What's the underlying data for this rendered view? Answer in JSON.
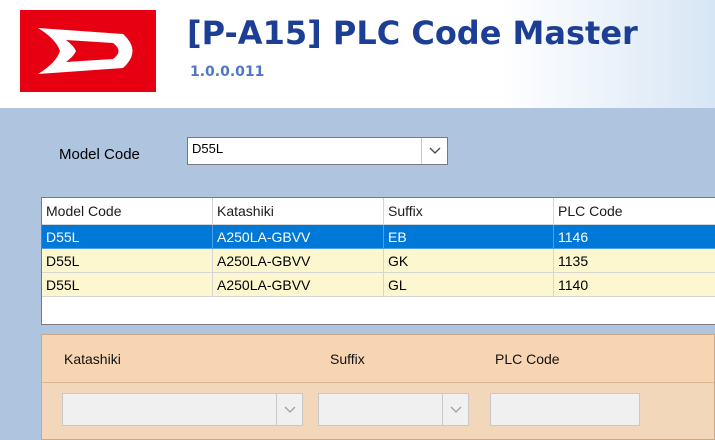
{
  "app": {
    "title": "[P-A15] PLC Code Master",
    "version": "1.0.0.011",
    "brand_color": "#e60012"
  },
  "filter": {
    "model_code_label": "Model Code",
    "model_code_value": "D55L"
  },
  "grid": {
    "columns": [
      "Model Code",
      "Katashiki",
      "Suffix",
      "PLC Code"
    ],
    "rows": [
      {
        "model_code": "D55L",
        "katashiki": "A250LA-GBVV",
        "suffix": "EB",
        "plc_code": "1146",
        "selected": true
      },
      {
        "model_code": "D55L",
        "katashiki": "A250LA-GBVV",
        "suffix": "GK",
        "plc_code": "1135",
        "selected": false
      },
      {
        "model_code": "D55L",
        "katashiki": "A250LA-GBVV",
        "suffix": "GL",
        "plc_code": "1140",
        "selected": false
      }
    ],
    "selected_color": "#0078d7",
    "row_color": "#fdf7cf"
  },
  "editor": {
    "katashiki_label": "Katashiki",
    "suffix_label": "Suffix",
    "plc_code_label": "PLC Code",
    "katashiki_value": "",
    "suffix_value": "",
    "plc_code_value": ""
  },
  "icons": [
    "logo-icon",
    "chevron-down-icon"
  ]
}
